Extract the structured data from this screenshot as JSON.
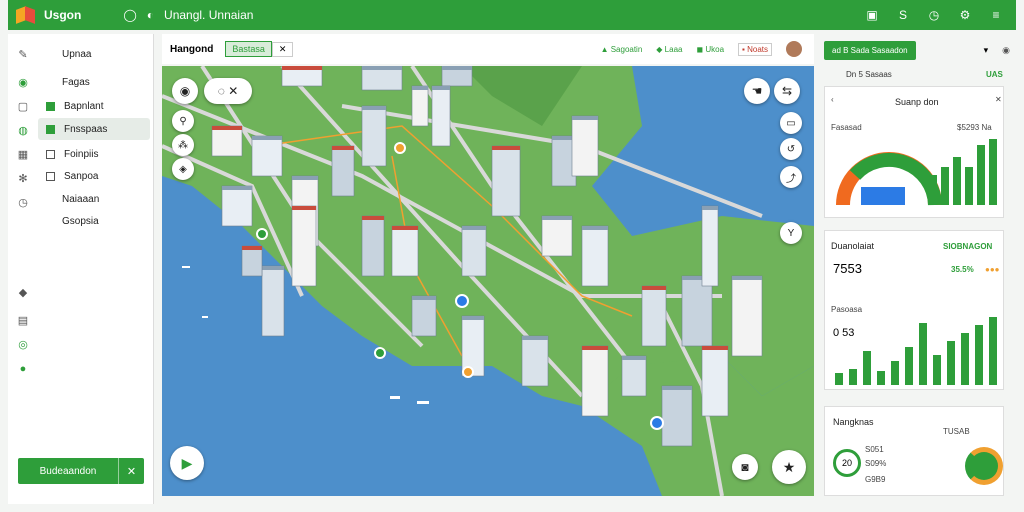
{
  "app": {
    "brand": "Usgon",
    "title": "Unangl. Unnaian"
  },
  "sidebar": {
    "items": [
      {
        "label": "Upnaa"
      },
      {
        "label": "Fagas"
      },
      {
        "label": "Bapnlant"
      },
      {
        "label": "Fnsspaas"
      },
      {
        "label": "Foinpiis"
      },
      {
        "label": "Sanpoa"
      },
      {
        "label": "Naiaaan"
      },
      {
        "label": "Gsopsia"
      }
    ],
    "action_button": "Budeaandon"
  },
  "map_header": {
    "title": "Hangond",
    "tag": "Bastasa",
    "tab1": "Sagoatin",
    "tab2": "Laaa",
    "tab3": "Ukoa",
    "tab4": "Noats"
  },
  "right_panel": {
    "top_button": "ad B Sada Sasaadon",
    "subtitle": "Dn 5 Sasaas",
    "subtitle_right": "UAS",
    "donut_card": {
      "title": "Suanp don",
      "label": "Fasasad",
      "value": "$5293 Na"
    },
    "metric_card": {
      "title": "Duanolaiat",
      "tag": "SIOBNAGON",
      "big_value": "7553",
      "pct": "35.5%"
    },
    "bar_card": {
      "label": "Pasoasa",
      "value": "0 53"
    },
    "bottom_card": {
      "title": "Nangknas",
      "a": "TUSAB",
      "v1": "20",
      "v2": "S051",
      "v3": "S09%",
      "v4": "G9B9"
    }
  },
  "colors": {
    "accent": "#2e9e3a",
    "water": "#4d8fcb",
    "land": "#6fb35a"
  }
}
